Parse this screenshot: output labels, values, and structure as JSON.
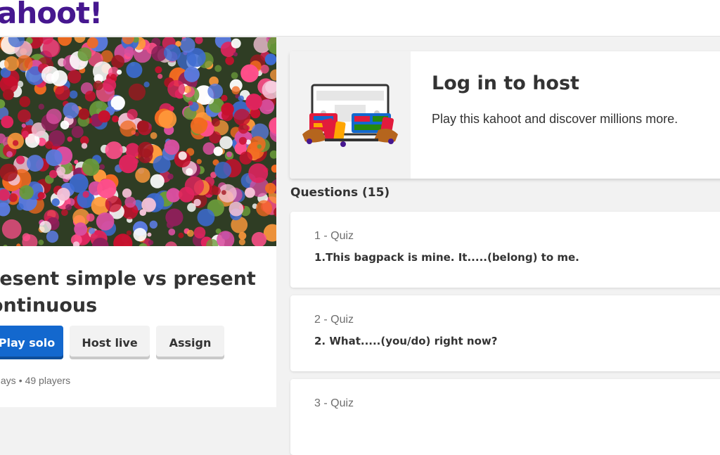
{
  "header": {
    "logo_text": "ahoot!",
    "brand_color": "#46178f"
  },
  "kahoot": {
    "title": "resent simple vs present ontinuous",
    "cover_image": "flower-bouquet-photo",
    "actions": {
      "play_solo": "Play solo",
      "host_live": "Host live",
      "assign": "Assign"
    },
    "stats": {
      "plays": "plays",
      "separator": "•",
      "players": "49 players"
    }
  },
  "host_card": {
    "title": "Log in to host",
    "subtitle": "Play this kahoot and discover millions more.",
    "illustration": "host-screen-illustration"
  },
  "questions": {
    "heading": "Questions (15)",
    "items": [
      {
        "type": "1 - Quiz",
        "text": "1.This bagpack is mine. It.....(belong) to me."
      },
      {
        "type": "2 - Quiz",
        "text": "2. What.....(you/do) right now?"
      },
      {
        "type": "3 - Quiz",
        "text": ""
      }
    ]
  },
  "colors": {
    "primary_button": "#1368ce",
    "secondary_button": "#f2f2f2",
    "background": "#f2f2f2"
  }
}
